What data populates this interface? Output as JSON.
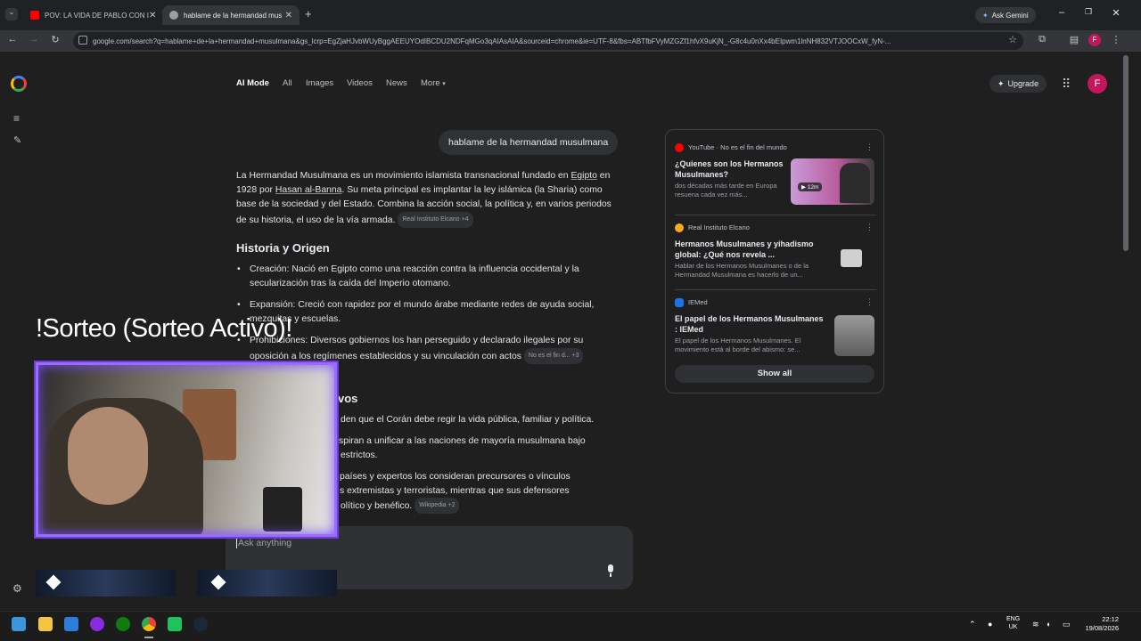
{
  "browser": {
    "tabs": [
      {
        "title": "POV: LA VIDA DE PABLO CON I",
        "active": false,
        "favicon_color": "#ff0000"
      },
      {
        "title": "hablame de la hermandad mus",
        "active": true,
        "favicon_color": "#9aa0a6"
      }
    ],
    "new_tab_icon": "plus-icon",
    "ask_gemini_label": "Ask Gemini",
    "url": "google.com/search?q=hablame+de+la+hermandad+musulmana&gs_lcrp=EgZjaHJvbWUyBggAEEUYOdIBCDU2NDFqMGo3qAIAsAIA&sourceid=chrome&ie=UTF-8&fbs=ABTfbFVyMZGZf1hfvX9uKjN_-G8c4u0nXx4bEIpwm1lnNH832VTJOOCxW_fyN-..."
  },
  "google": {
    "nav_tabs": [
      "AI Mode",
      "All",
      "Images",
      "Videos",
      "News",
      "More"
    ],
    "upgrade_label": "Upgrade",
    "avatar_letter": "F",
    "user_query": "hablame de la hermandad musulmana",
    "intro": {
      "p1": "La Hermandad Musulmana es un movimiento islamista transnacional fundado en ",
      "egipto": "Egipto",
      "p2": " en 1928 por ",
      "hasan": "Hasan al-Banna",
      "p3": ". Su meta principal es implantar la ley islámica (la Sharia) como base de la sociedad y del Estado. Combina la acción social, la política y, en varios periodos de su historia, el uso de la vía armada. ",
      "chip": "Real Instituto Elcano +4"
    },
    "section1_title": "Historia y Origen",
    "bullets": [
      {
        "label": "Creación:",
        "text": " Nació en Egipto como una reacción contra la influencia occidental y la secularización tras la caída del Imperio otomano."
      },
      {
        "label": "Expansión:",
        "text": " Creció con rapidez por el mundo árabe mediante redes de ayuda social, mezquitas y escuelas."
      },
      {
        "label": "Prohibiciones:",
        "text": " Diversos gobiernos los han perseguido y declarado ilegales por su oposición a los regímenes establecidos y su vinculación con actos",
        "chip": "No es el fin d... +3"
      }
    ],
    "section2_partial": "vos",
    "bullets2": [
      "den que el Corán debe regir la vida pública, familiar y política.",
      "spiran a unificar a las naciones de mayoría musulmana bajo",
      "estrictos.",
      "países y expertos los consideran precursores o vínculos",
      "s extremistas y terroristas, mientras que sus defensores",
      "olítico y benéfico."
    ],
    "chip_wikipedia": "Wikipedia +2",
    "ask_placeholder": "Ask anything"
  },
  "sources": [
    {
      "site": "YouTube",
      "site_extra": "No es el fin del mundo",
      "title": "¿Quienes son los Hermanos Musulmanes?",
      "snippet": "dos décadas más tarde en Europa resuena cada vez más...",
      "duration": "12m",
      "color": "#ff0000"
    },
    {
      "site": "Real Instituto Elcano",
      "site_extra": "",
      "title": "Hermanos Musulmanes y yihadismo global: ¿Qué nos revela ...",
      "snippet": "Hablar de los Hermanos Musulmanes o de la Hermandad Musulmana es hacerlo de un...",
      "duration": "",
      "color": "#f9a825"
    },
    {
      "site": "IEMed",
      "site_extra": "",
      "title": "El papel de los Hermanos Musulmanes : IEMed",
      "snippet": "El papel de los Hermanos Musulmanes. El movimiento está al borde del abismo: se...",
      "duration": "",
      "color": "#1a73e8"
    }
  ],
  "show_all_label": "Show all",
  "overlay": {
    "sorteo_text": "!Sorteo (Sorteo Activo)!"
  },
  "taskbar": {
    "lang_top": "ENG",
    "lang_bottom": "UK",
    "time": "22:12",
    "date": "19/08/2026"
  },
  "colors": {
    "accent": "#8ab4f8",
    "avatar": "#c2185b",
    "overlay_purple": "#6a3fd8"
  }
}
